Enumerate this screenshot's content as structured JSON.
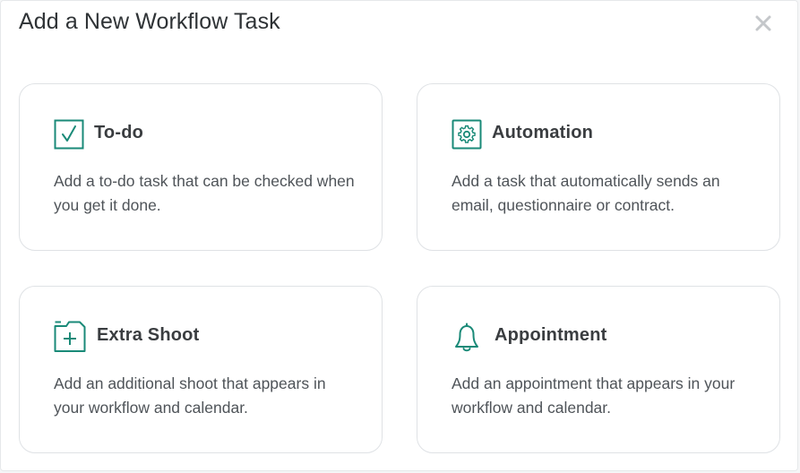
{
  "modal": {
    "title": "Add a New Workflow Task",
    "close_icon": "close-icon"
  },
  "colors": {
    "accent": "#1a8a78",
    "title_text": "#2f3336",
    "card_title": "#3a3d40",
    "body_text": "#4f5459",
    "card_border": "#dfe2e5",
    "close_icon": "#c4c7ca"
  },
  "cards": [
    {
      "icon": "checkbox-check-icon",
      "title": "To-do",
      "description": "Add a to-do task that can be checked when you get it done."
    },
    {
      "icon": "gear-icon",
      "title": "Automation",
      "description": "Add a task that automatically sends an email, questionnaire or contract."
    },
    {
      "icon": "folder-plus-icon",
      "title": "Extra Shoot",
      "description": "Add an additional shoot that appears in your workflow and calendar."
    },
    {
      "icon": "bell-icon",
      "title": "Appointment",
      "description": "Add an appointment that appears in your workflow and calendar."
    }
  ]
}
